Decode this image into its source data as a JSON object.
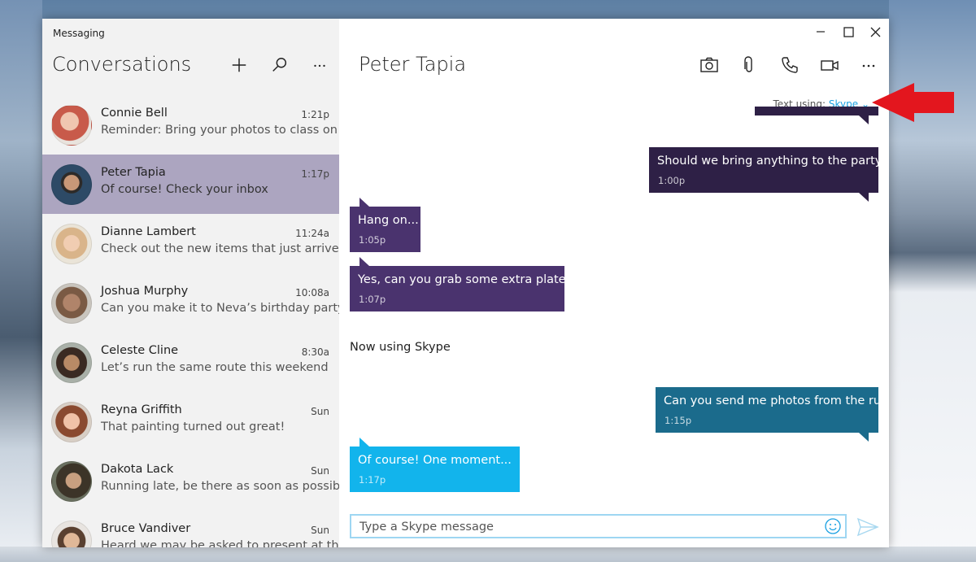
{
  "app": {
    "title": "Messaging"
  },
  "sidebar": {
    "title": "Conversations",
    "icons": [
      "plus-icon",
      "search-icon",
      "more-icon"
    ],
    "conversations": [
      {
        "name": "Connie Bell",
        "time": "1:21p",
        "preview": "Reminder: Bring your photos to class on Thu",
        "avatar_color": "#c85a4a"
      },
      {
        "name": "Peter Tapia",
        "time": "1:17p",
        "preview": "Of course! Check your inbox",
        "avatar_color": "#2d4a66",
        "selected": true
      },
      {
        "name": "Dianne Lambert",
        "time": "11:24a",
        "preview": "Check out the new items that just arrived",
        "avatar_color": "#d9b48a"
      },
      {
        "name": "Joshua Murphy",
        "time": "10:08a",
        "preview": "Can you make it to Neva’s birthday party?",
        "avatar_color": "#7a5a44"
      },
      {
        "name": "Celeste Cline",
        "time": "8:30a",
        "preview": "Let’s run the same route this weekend",
        "avatar_color": "#6b4a36"
      },
      {
        "name": "Reyna Griffith",
        "time": "Sun",
        "preview": "That painting turned out great!",
        "avatar_color": "#c47a62"
      },
      {
        "name": "Dakota Lack",
        "time": "Sun",
        "preview": "Running late, be there as soon as possible",
        "avatar_color": "#4f4636"
      },
      {
        "name": "Bruce Vandiver",
        "time": "Sun",
        "preview": "Heard we may be asked to present at the sp",
        "avatar_color": "#8a6a58"
      }
    ]
  },
  "chat": {
    "title": "Peter Tapia",
    "toolbar_icons": [
      "camera-icon",
      "attach-icon",
      "phone-icon",
      "video-icon",
      "more-icon"
    ],
    "text_using_label": "Text using:",
    "text_using_service": "Skype",
    "status_line": "Now using Skype",
    "messages": [
      {
        "text": "Should we bring anything to the party?",
        "time": "1:00p",
        "side": "right",
        "color": "#2e2046"
      },
      {
        "text": "Hang on...",
        "time": "1:05p",
        "side": "left",
        "color": "#4a336e"
      },
      {
        "text": "Yes, can you grab some extra plates?",
        "time": "1:07p",
        "side": "left",
        "color": "#4a336e"
      },
      {
        "text": "Can you send me photos from the run",
        "time": "1:15p",
        "side": "right",
        "color": "#1b6b8c"
      },
      {
        "text": "Of course!  One moment...",
        "time": "1:17p",
        "side": "left",
        "color": "#12b4ec"
      }
    ],
    "input_placeholder": "Type a Skype message"
  },
  "colors": {
    "accent": "#1ba1e2",
    "selected_row": "#aca5c0",
    "arrow": "#e3161e"
  }
}
